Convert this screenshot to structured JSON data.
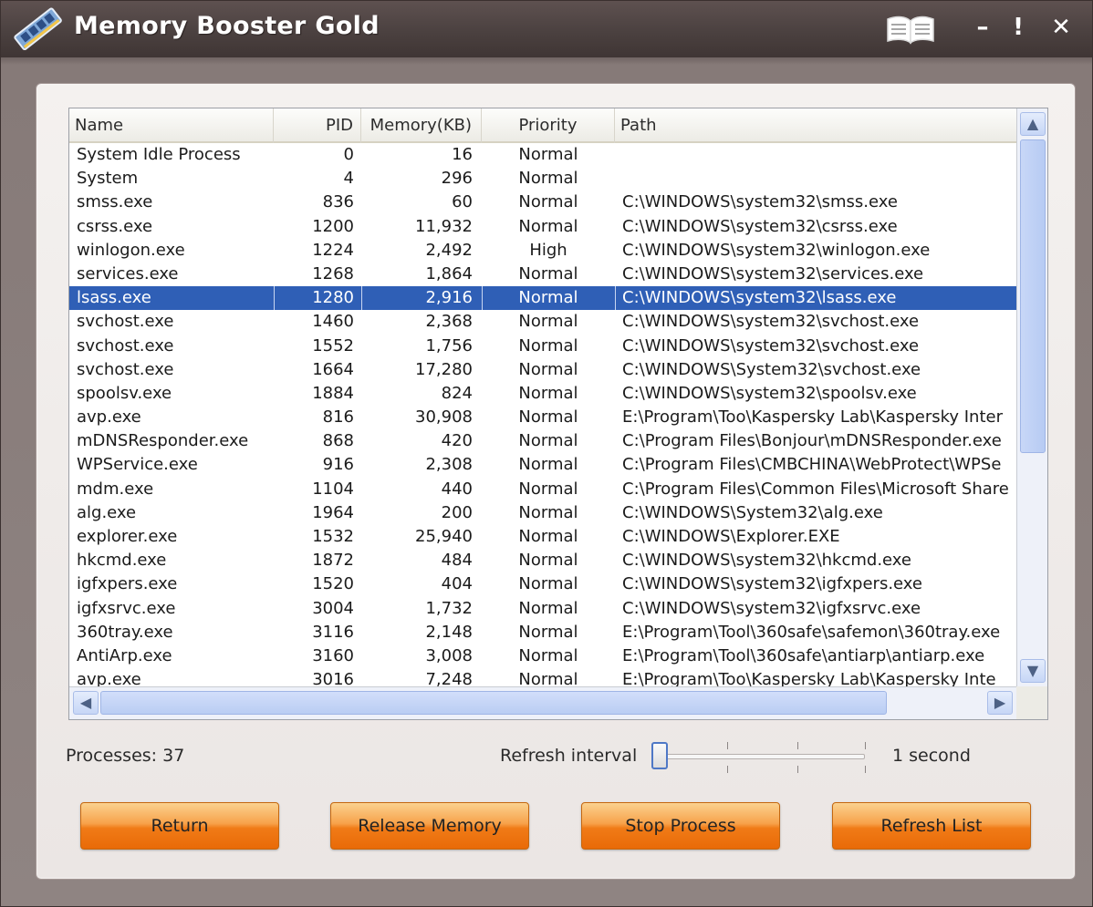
{
  "window": {
    "title": "Memory Booster Gold",
    "controls": {
      "minimize": "–",
      "help": "!",
      "close": "✕"
    }
  },
  "list": {
    "columns": [
      "Name",
      "PID",
      "Memory(KB)",
      "Priority",
      "Path"
    ],
    "selected_index": 6,
    "rows": [
      {
        "name": "System Idle Process",
        "pid": "0",
        "memory": "16",
        "priority": "Normal",
        "path": ""
      },
      {
        "name": "System",
        "pid": "4",
        "memory": "296",
        "priority": "Normal",
        "path": ""
      },
      {
        "name": "smss.exe",
        "pid": "836",
        "memory": "60",
        "priority": "Normal",
        "path": "C:\\WINDOWS\\system32\\smss.exe"
      },
      {
        "name": "csrss.exe",
        "pid": "1200",
        "memory": "11,932",
        "priority": "Normal",
        "path": "C:\\WINDOWS\\system32\\csrss.exe"
      },
      {
        "name": "winlogon.exe",
        "pid": "1224",
        "memory": "2,492",
        "priority": "High",
        "path": "C:\\WINDOWS\\system32\\winlogon.exe"
      },
      {
        "name": "services.exe",
        "pid": "1268",
        "memory": "1,864",
        "priority": "Normal",
        "path": "C:\\WINDOWS\\system32\\services.exe"
      },
      {
        "name": "lsass.exe",
        "pid": "1280",
        "memory": "2,916",
        "priority": "Normal",
        "path": "C:\\WINDOWS\\system32\\lsass.exe"
      },
      {
        "name": "svchost.exe",
        "pid": "1460",
        "memory": "2,368",
        "priority": "Normal",
        "path": "C:\\WINDOWS\\system32\\svchost.exe"
      },
      {
        "name": "svchost.exe",
        "pid": "1552",
        "memory": "1,756",
        "priority": "Normal",
        "path": "C:\\WINDOWS\\system32\\svchost.exe"
      },
      {
        "name": "svchost.exe",
        "pid": "1664",
        "memory": "17,280",
        "priority": "Normal",
        "path": "C:\\WINDOWS\\System32\\svchost.exe"
      },
      {
        "name": "spoolsv.exe",
        "pid": "1884",
        "memory": "824",
        "priority": "Normal",
        "path": "C:\\WINDOWS\\system32\\spoolsv.exe"
      },
      {
        "name": "avp.exe",
        "pid": "816",
        "memory": "30,908",
        "priority": "Normal",
        "path": "E:\\Program\\Too\\Kaspersky Lab\\Kaspersky Inter"
      },
      {
        "name": "mDNSResponder.exe",
        "pid": "868",
        "memory": "420",
        "priority": "Normal",
        "path": "C:\\Program Files\\Bonjour\\mDNSResponder.exe"
      },
      {
        "name": "WPService.exe",
        "pid": "916",
        "memory": "2,308",
        "priority": "Normal",
        "path": "C:\\Program Files\\CMBCHINA\\WebProtect\\WPSe"
      },
      {
        "name": "mdm.exe",
        "pid": "1104",
        "memory": "440",
        "priority": "Normal",
        "path": "C:\\Program Files\\Common Files\\Microsoft Share"
      },
      {
        "name": "alg.exe",
        "pid": "1964",
        "memory": "200",
        "priority": "Normal",
        "path": "C:\\WINDOWS\\System32\\alg.exe"
      },
      {
        "name": "explorer.exe",
        "pid": "1532",
        "memory": "25,940",
        "priority": "Normal",
        "path": "C:\\WINDOWS\\Explorer.EXE"
      },
      {
        "name": "hkcmd.exe",
        "pid": "1872",
        "memory": "484",
        "priority": "Normal",
        "path": "C:\\WINDOWS\\system32\\hkcmd.exe"
      },
      {
        "name": "igfxpers.exe",
        "pid": "1520",
        "memory": "404",
        "priority": "Normal",
        "path": "C:\\WINDOWS\\system32\\igfxpers.exe"
      },
      {
        "name": "igfxsrvc.exe",
        "pid": "3004",
        "memory": "1,732",
        "priority": "Normal",
        "path": "C:\\WINDOWS\\system32\\igfxsrvc.exe"
      },
      {
        "name": "360tray.exe",
        "pid": "3116",
        "memory": "2,148",
        "priority": "Normal",
        "path": "E:\\Program\\Tool\\360safe\\safemon\\360tray.exe"
      },
      {
        "name": "AntiArp.exe",
        "pid": "3160",
        "memory": "3,008",
        "priority": "Normal",
        "path": "E:\\Program\\Tool\\360safe\\antiarp\\antiarp.exe"
      },
      {
        "name": "avp.exe",
        "pid": "3016",
        "memory": "7,248",
        "priority": "Normal",
        "path": "E:\\Program\\Too\\Kaspersky Lab\\Kaspersky Inte"
      }
    ]
  },
  "status": {
    "processes": "Processes: 37",
    "refresh_label": "Refresh interval",
    "refresh_value": "1 second",
    "slider_level": 0
  },
  "buttons": {
    "return": "Return",
    "release_memory": "Release Memory",
    "stop_process": "Stop Process",
    "refresh_list": "Refresh List"
  },
  "icons": {
    "app": "memory-stick-icon",
    "manual": "book-icon"
  },
  "colors": {
    "selection": "#2f5fb6",
    "button": "#f07b17",
    "titlebar": "#4b4140"
  }
}
